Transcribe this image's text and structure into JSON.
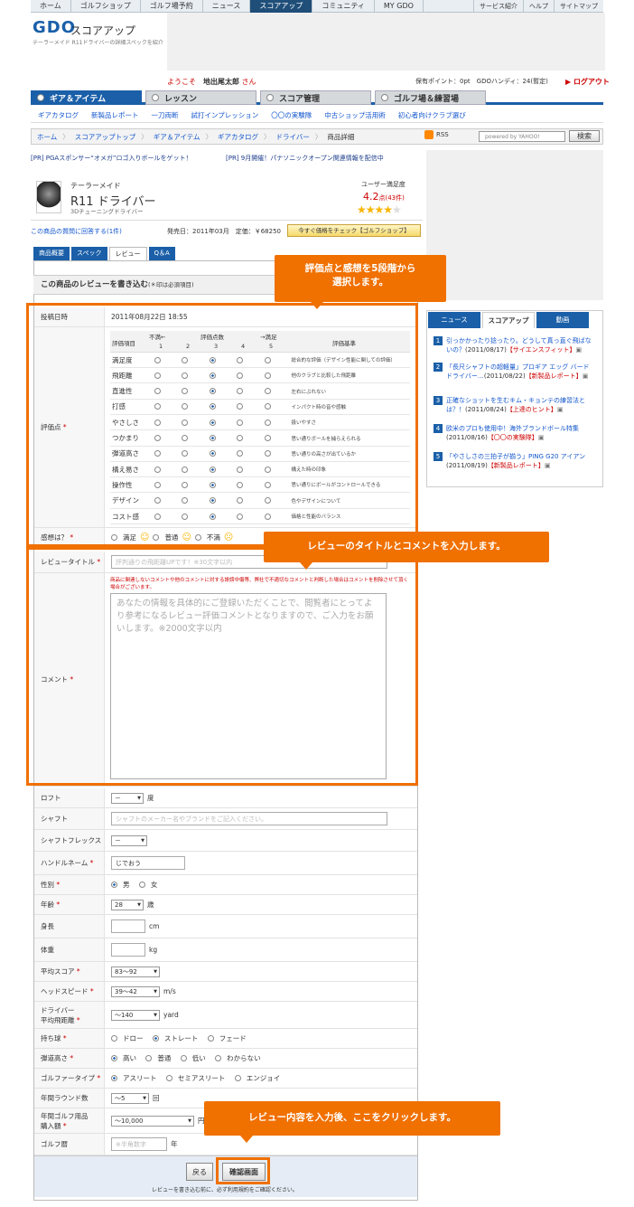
{
  "topnav": {
    "items": [
      "ホーム",
      "ゴルフショップ",
      "ゴルフ場予約",
      "ニュース",
      "スコアアップ",
      "コミュニティ",
      "MY GDO"
    ],
    "right": [
      "サービス紹介",
      "ヘルプ",
      "サイトマップ"
    ]
  },
  "header": {
    "logo": "GDO",
    "title": "スコアアップ",
    "desc": "テーラーメイド R11ドライバーの詳細スペックを紹介",
    "welcome_prefix": "ようこそ",
    "user": "地出尾太郎",
    "welcome_suffix": "さん",
    "points": "保有ポイント：0pt　GDOハンディ：24(暫定)",
    "logout": "ログアウト"
  },
  "tabs": [
    "ギア＆アイテム",
    "レッスン",
    "スコア管理",
    "ゴルフ場＆練習場"
  ],
  "subnav": [
    "ギアカタログ",
    "新製品レポート",
    "一刀両断",
    "試打インプレッション",
    "〇〇の実験隊",
    "中古ショップ活用術",
    "初心者向けクラブ選び"
  ],
  "breadcrumb": [
    "ホーム",
    "スコアアップトップ",
    "ギア＆アイテム",
    "ギアカタログ",
    "ドライバー",
    "商品詳細"
  ],
  "rss": "RSS",
  "search": {
    "placeholder": "powered by YAHOO!",
    "button": "検索"
  },
  "pr": [
    "[PR] PGAスポンサー“オメガ”ロゴ入りボールをゲット！",
    "[PR] 9月開催！パナソニックオープン関連情報を配信中"
  ],
  "product": {
    "maker": "テーラーメイド",
    "name": "R11 ドライバー",
    "sub": "3Dチューニングドライバー",
    "rating_label": "ユーザー満足度",
    "rating": "4.2",
    "rating_unit": "点",
    "rating_count": "(43件)",
    "stars": 4.2,
    "question_link": "この商品の質問に回答する(1件)",
    "release": "発売日：2011年03月　定価：￥68250",
    "price_btn": "今すぐ価格をチェック【ゴルフショップ】"
  },
  "product_tabs": [
    "商品概要",
    "スペック",
    "レビュー",
    "Q＆A"
  ],
  "form": {
    "heading": "この商品のレビューを書き込む",
    "heading_note": "(＊印は必須項目)",
    "post_date_label": "投稿日時",
    "post_date": "2011年08月22日 18:55",
    "eval_label": "評価点",
    "eval_head": {
      "item": "評価項目",
      "low": "不満←",
      "mid": "評価点数",
      "high": "→満足",
      "basis": "評価基準",
      "scale": [
        "1",
        "2",
        "3",
        "4",
        "5"
      ]
    },
    "eval_rows": [
      {
        "name": "満足度",
        "selected": 3,
        "basis": "総合的な評価（デザイン性能に関しての評価）"
      },
      {
        "name": "飛距離",
        "selected": 3,
        "basis": "他のクラブと比較した飛距離"
      },
      {
        "name": "直進性",
        "selected": 3,
        "basis": "左右にぶれない"
      },
      {
        "name": "打感",
        "selected": 3,
        "basis": "インパクト時の音や感触"
      },
      {
        "name": "やさしさ",
        "selected": 3,
        "basis": "扱いやすさ"
      },
      {
        "name": "つかまり",
        "selected": 3,
        "basis": "思い通りボールを捕らえられる"
      },
      {
        "name": "弾道高さ",
        "selected": 3,
        "basis": "思い通りの高さが出ているか"
      },
      {
        "name": "構え易さ",
        "selected": 3,
        "basis": "構えた時の印象"
      },
      {
        "name": "操作性",
        "selected": 3,
        "basis": "思い通りにボールがコントロールできる"
      },
      {
        "name": "デザイン",
        "selected": 3,
        "basis": "色やデザインについて"
      },
      {
        "name": "コスト感",
        "selected": 3,
        "basis": "価格と性能のバランス"
      }
    ],
    "feeling_label": "感想は？",
    "feeling_options": [
      "満足",
      "普通",
      "不満"
    ],
    "title_label": "レビュータイトル",
    "title_placeholder": "評判通りの飛距離UPです！※30文字以内",
    "note": "商品に関連しないコメントや他のコメントに対する誹謗中傷等、弊社で不適切なコメントと判断した場合はコメントを削除させて頂く場合がございます。",
    "comment_label": "コメント",
    "comment_placeholder": "あなたの情報を具体的にご登録いただくことで、閲覧者にとってより参考になるレビュー評価コメントとなりますので、ご入力をお願いします。※2000文字以内",
    "loft_label": "ロフト",
    "loft_value": "－",
    "loft_unit": "度",
    "shaft_label": "シャフト",
    "shaft_placeholder": "シャフトのメーカー名やブランドをご記入ください。",
    "flex_label": "シャフトフレックス",
    "flex_value": "－",
    "handle_label": "ハンドルネーム",
    "handle_value": "じでおう",
    "gender_label": "性別",
    "gender_options": [
      "男",
      "女"
    ],
    "age_label": "年齢",
    "age_value": "28",
    "age_unit": "歳",
    "height_label": "身長",
    "height_unit": "cm",
    "weight_label": "体重",
    "weight_unit": "kg",
    "score_label": "平均スコア",
    "score_value": "83〜92",
    "hs_label": "ヘッドスピード",
    "hs_value": "39〜42",
    "hs_unit": "m/s",
    "dist_label1": "ドライバー",
    "dist_label2": "平均飛距離",
    "dist_value": "〜140",
    "dist_unit": "yard",
    "ball_label": "持ち球",
    "ball_options": [
      "ドロー",
      "ストレート",
      "フェード"
    ],
    "traj_label": "弾道高さ",
    "traj_options": [
      "高い",
      "普通",
      "低い",
      "わからない"
    ],
    "type_label": "ゴルファータイプ",
    "type_options": [
      "アスリート",
      "セミアスリート",
      "エンジョイ"
    ],
    "rounds_label": "年間ラウンド数",
    "rounds_value": "〜5",
    "rounds_unit": "回",
    "spend_label1": "年間ゴルフ用品",
    "spend_label2": "購入額",
    "spend_value": "〜10,000",
    "spend_unit": "円",
    "history_label": "ゴルフ暦",
    "history_placeholder": "※半角数字",
    "history_unit": "年",
    "back_btn": "戻る",
    "confirm_btn": "確認画面",
    "footer_note": "レビューを書き込む前に、必ず利用規約をご確認ください。"
  },
  "callouts": {
    "c1": "評価点と感想を5段階から\n選択します。",
    "c2": "レビューのタイトルとコメントを入力します。",
    "c3": "レビュー内容を入力後、ここをクリックします。"
  },
  "right_tabs": [
    "ニュース",
    "スコアアップ",
    "動画"
  ],
  "news": [
    {
      "num": "1",
      "title": "引っかかったり捻ったり。どうして真っ直ぐ飛ばないの？",
      "date": "(2011/08/17)",
      "cat": "【サイエンスフィット】"
    },
    {
      "num": "2",
      "title": "「長尺シャフトの超軽量」プロギア エッグ バードドライバー…",
      "date": "(2011/08/22)",
      "cat": "【新製品レポート】"
    },
    {
      "num": "3",
      "title": "正確なショットを生むキム・キョンテの練習法とは？！",
      "date": "(2011/08/24)",
      "cat": "【上達のヒント】"
    },
    {
      "num": "4",
      "title": "欧米のプロも使用中！海外ブランドボール特集",
      "date": "(2011/08/16)",
      "cat": "【〇〇の実験隊】"
    },
    {
      "num": "5",
      "title": "「やさしさの三拍子が揃う」PING G20 アイアン",
      "date": "(2011/08/19)",
      "cat": "【新製品レポート】"
    }
  ]
}
